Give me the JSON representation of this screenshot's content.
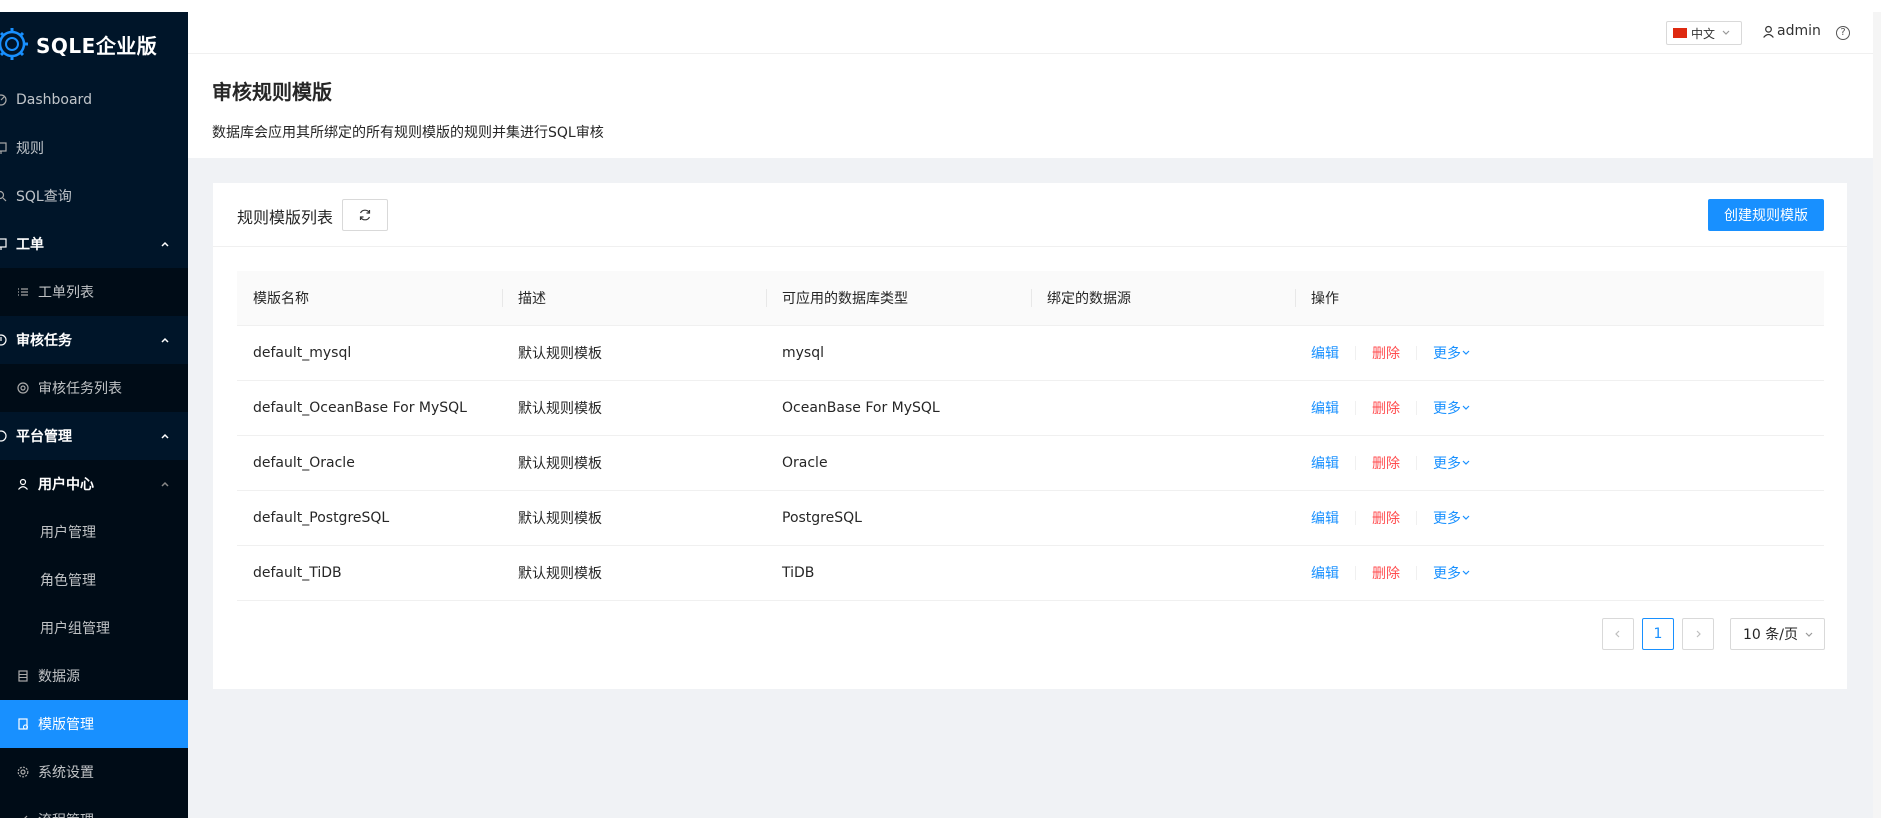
{
  "app": {
    "logo_text": "SQLE企业版"
  },
  "sidebar": {
    "items": [
      {
        "label": "Dashboard"
      },
      {
        "label": "规则"
      },
      {
        "label": "SQL查询"
      },
      {
        "label": "工单"
      },
      {
        "label": "工单列表"
      },
      {
        "label": "审核任务"
      },
      {
        "label": "审核任务列表"
      },
      {
        "label": "平台管理"
      },
      {
        "label": "用户中心"
      },
      {
        "label": "用户管理"
      },
      {
        "label": "角色管理"
      },
      {
        "label": "用户组管理"
      },
      {
        "label": "数据源"
      },
      {
        "label": "模版管理"
      },
      {
        "label": "系统设置"
      },
      {
        "label": "流程管理"
      }
    ]
  },
  "header": {
    "language": "中文",
    "username": "admin",
    "help_glyph": "?"
  },
  "page": {
    "title": "审核规则模版",
    "description": "数据库会应用其所绑定的所有规则模版的规则并集进行SQL审核"
  },
  "card": {
    "title": "规则模版列表",
    "create_label": "创建规则模版"
  },
  "table": {
    "headers": [
      "模版名称",
      "描述",
      "可应用的数据库类型",
      "绑定的数据源",
      "操作"
    ],
    "rows": [
      {
        "name": "default_mysql",
        "desc": "默认规则模板",
        "db_type": "mysql",
        "datasource": ""
      },
      {
        "name": "default_OceanBase For MySQL",
        "desc": "默认规则模板",
        "db_type": "OceanBase For MySQL",
        "datasource": ""
      },
      {
        "name": "default_Oracle",
        "desc": "默认规则模板",
        "db_type": "Oracle",
        "datasource": ""
      },
      {
        "name": "default_PostgreSQL",
        "desc": "默认规则模板",
        "db_type": "PostgreSQL",
        "datasource": ""
      },
      {
        "name": "default_TiDB",
        "desc": "默认规则模板",
        "db_type": "TiDB",
        "datasource": ""
      }
    ],
    "actions": {
      "edit": "编辑",
      "delete": "删除",
      "more": "更多"
    }
  },
  "pagination": {
    "current_page": "1",
    "page_size": "10 条/页"
  },
  "colors": {
    "sidebar_bg": "#001529",
    "accent": "#1890ff",
    "danger": "#ff4d4f"
  }
}
